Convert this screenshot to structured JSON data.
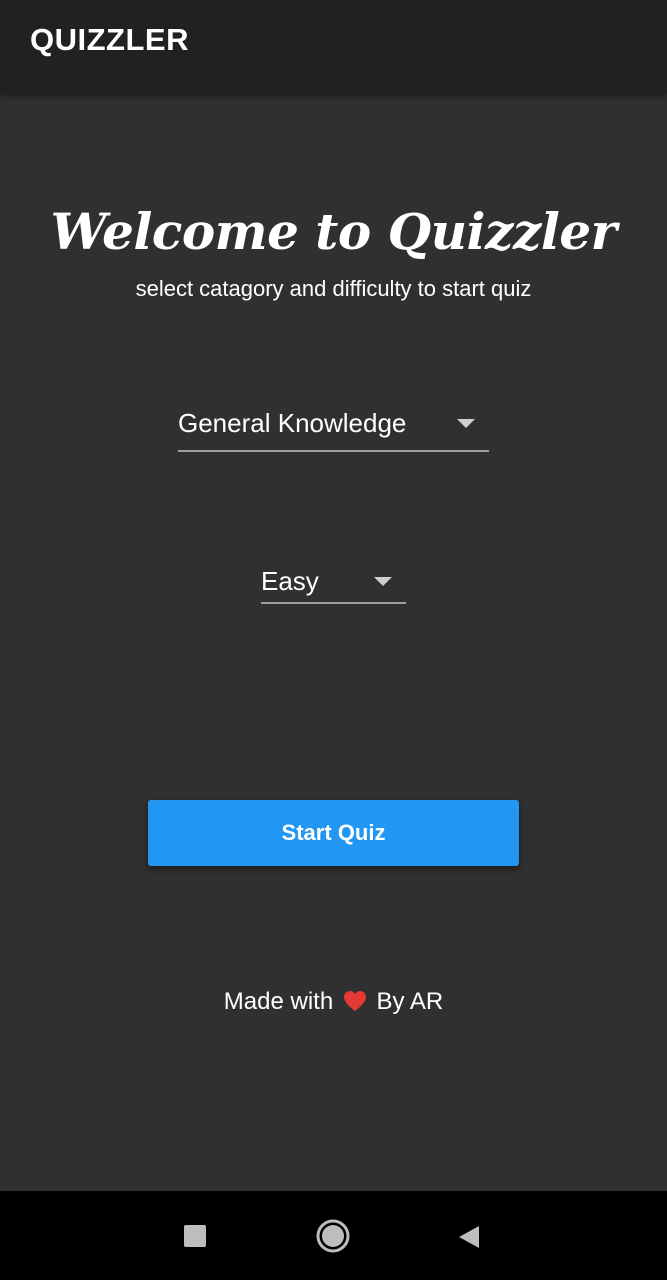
{
  "app_bar": {
    "title": "QUIZZLER"
  },
  "main": {
    "welcome_title": "Welcome to Quizzler",
    "subtitle": "select catagory and difficulty to start quiz",
    "category_dropdown": {
      "selected": "General Knowledge"
    },
    "difficulty_dropdown": {
      "selected": "Easy"
    },
    "start_button_label": "Start Quiz"
  },
  "footer": {
    "prefix": "Made with",
    "suffix": "By AR",
    "icon": "heart-icon"
  },
  "nav_bar": {
    "icons": [
      "recents-icon",
      "home-icon",
      "back-icon"
    ]
  },
  "colors": {
    "background": "#303030",
    "app_bar": "#212121",
    "accent": "#2196f3",
    "heart": "#e53935",
    "nav_bar": "#000000"
  }
}
